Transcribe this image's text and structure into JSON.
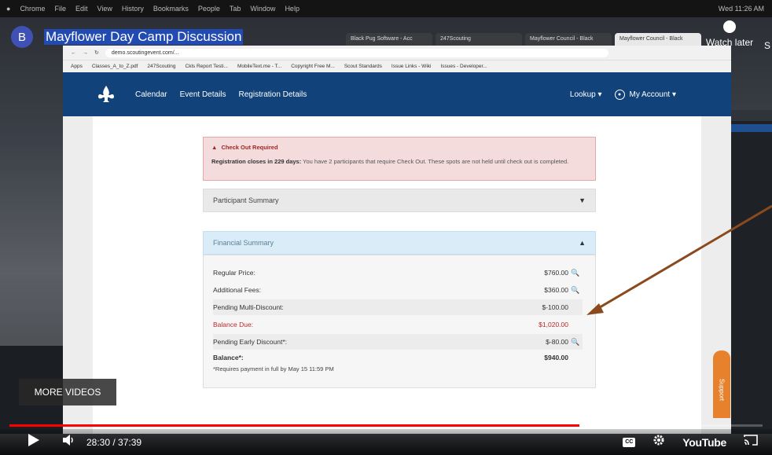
{
  "mac_menu": [
    "Chrome",
    "File",
    "Edit",
    "View",
    "History",
    "Bookmarks",
    "People",
    "Tab",
    "Window",
    "Help"
  ],
  "mac_clock": "Wed 11:26 AM",
  "browser": {
    "tabs": [
      "Black Pug Software - Acc",
      "247Scouting",
      "Mayflower Council - Black",
      "Mayflower Council - Black"
    ],
    "url": "demo.scoutingevent.com/...",
    "bookmarks": [
      "Apps",
      "Classes_A_to_Z.pdf",
      "247Scouting",
      "Ckls Report Testi...",
      "MobileText.me - T...",
      "Copyright Free M...",
      "Scout Standards",
      "Issue Links - Wiki",
      "Issues - Developer..."
    ]
  },
  "site": {
    "nav": {
      "calendar": "Calendar",
      "event_details": "Event Details",
      "registration_details": "Registration Details",
      "lookup": "Lookup ▾",
      "my_account": "My Account ▾"
    },
    "alert": {
      "title": "Check Out Required",
      "lead": "Registration closes in 229 days:",
      "body": " You have 2 participants that require Check Out. These spots are not held until check out is completed."
    },
    "participant_summary": "Participant Summary",
    "financial_summary": "Financial Summary",
    "rows": [
      {
        "label": "Regular Price:",
        "value": "$760.00",
        "zoom": true
      },
      {
        "label": "Additional Fees:",
        "value": "$360.00",
        "zoom": true
      },
      {
        "label": "Pending Multi-Discount:",
        "value": "$-100.00",
        "zoom": false
      },
      {
        "label": "Balance Due:",
        "value": "$1,020.00",
        "zoom": false
      },
      {
        "label": "Pending Early Discount*:",
        "value": "$-80.00",
        "zoom": true
      },
      {
        "label": "Balance*:",
        "value": "$940.00",
        "zoom": false
      }
    ],
    "note": "*Requires payment in full by May 15 11:59 PM",
    "support": "Support"
  },
  "youtube": {
    "channel_initial": "B",
    "title": "Mayflower Day Camp Discussion",
    "watch_later": "Watch later",
    "share_partial": "S",
    "more_videos": "MORE VIDEOS",
    "time": "28:30 / 37:39",
    "progress": 0.757,
    "logo": "YouTube"
  }
}
